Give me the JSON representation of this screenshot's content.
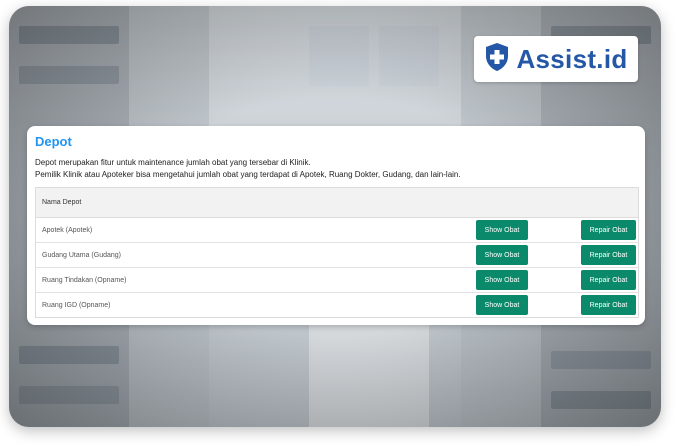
{
  "logo": {
    "text": "Assist.id",
    "icon": "shield-plus-icon",
    "color": "#2457a6"
  },
  "card": {
    "title": "Depot",
    "description_line1": "Depot merupakan fitur untuk maintenance jumlah obat yang tersebar di Klinik.",
    "description_line2": "Pemilik Klinik atau Apoteker bisa mengetahui jumlah obat yang terdapat di Apotek, Ruang Dokter, Gudang, dan lain-lain."
  },
  "table": {
    "header": "Nama Depot",
    "rows": [
      {
        "name": "Apotek (Apotek)",
        "show_label": "Show Obat",
        "repair_label": "Repair Obat"
      },
      {
        "name": "Gudang Utama (Gudang)",
        "show_label": "Show Obat",
        "repair_label": "Repair Obat"
      },
      {
        "name": "Ruang Tindakan (Opname)",
        "show_label": "Show Obat",
        "repair_label": "Repair Obat"
      },
      {
        "name": "Ruang IGD (Opname)",
        "show_label": "Show Obat",
        "repair_label": "Repair Obat"
      }
    ]
  },
  "colors": {
    "accent": "#2196f3",
    "button": "#0a8a6a"
  }
}
